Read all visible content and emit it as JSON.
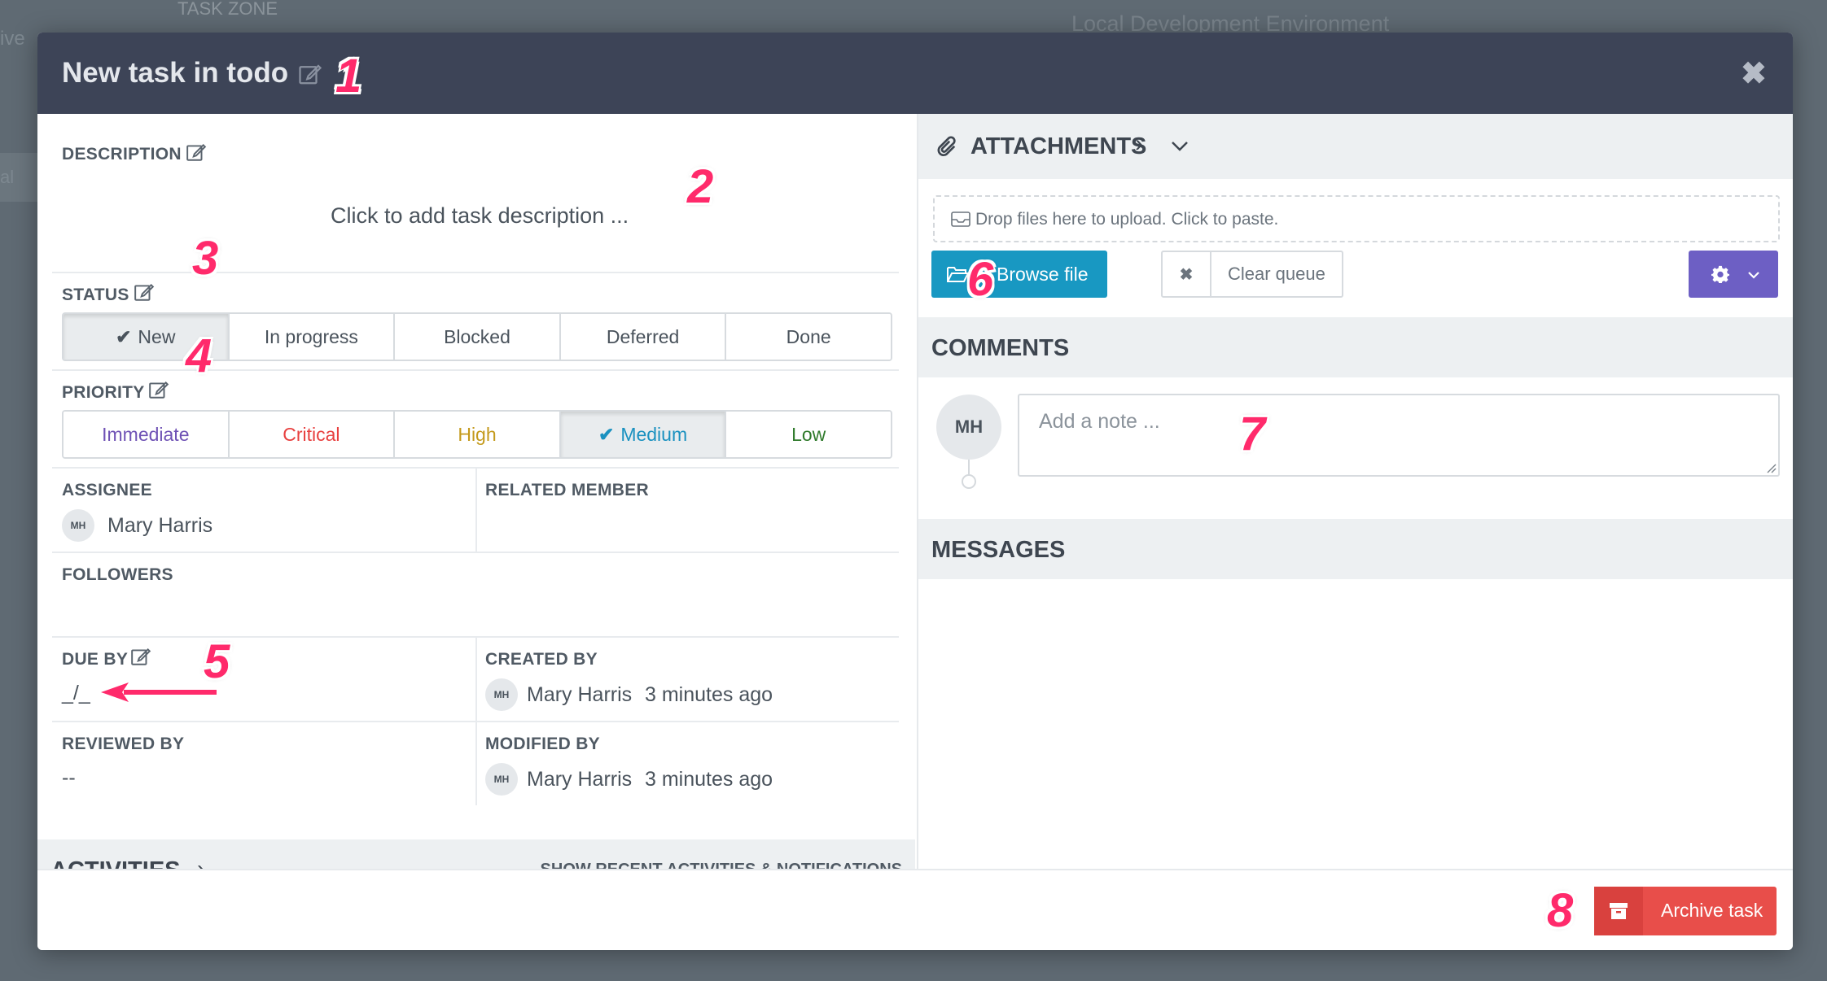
{
  "background": {
    "left_fragment": "ive",
    "top_fragment": "TASK ZONE",
    "right_title": "Local Development Environment",
    "side_fragment": "al"
  },
  "modal": {
    "title": "New task in todo"
  },
  "description": {
    "label": "DESCRIPTION",
    "placeholder": "Click to add task description ..."
  },
  "status": {
    "label": "STATUS",
    "options": [
      "New",
      "In progress",
      "Blocked",
      "Deferred",
      "Done"
    ],
    "selected": "New"
  },
  "priority": {
    "label": "PRIORITY",
    "options": [
      "Immediate",
      "Critical",
      "High",
      "Medium",
      "Low"
    ],
    "selected": "Medium",
    "colors": {
      "Immediate": "#6f52b5",
      "Critical": "#e8403f",
      "High": "#c49a1c",
      "Medium": "#1a91c0",
      "Low": "#2f7a2b"
    }
  },
  "assignee": {
    "label": "ASSIGNEE",
    "initials": "MH",
    "name": "Mary Harris"
  },
  "related_member": {
    "label": "RELATED MEMBER"
  },
  "followers": {
    "label": "FOLLOWERS"
  },
  "due_by": {
    "label": "DUE BY",
    "value": "_/_"
  },
  "created_by": {
    "label": "CREATED BY",
    "initials": "MH",
    "name": "Mary Harris",
    "time": "3 minutes ago"
  },
  "reviewed_by": {
    "label": "REVIEWED BY",
    "value": "--"
  },
  "modified_by": {
    "label": "MODIFIED BY",
    "initials": "MH",
    "name": "Mary Harris",
    "time": "3 minutes ago"
  },
  "activities": {
    "title": "ACTIVITIES",
    "link": "SHOW RECENT ACTIVITIES & NOTIFICATIONS"
  },
  "attachments": {
    "title": "ATTACHMENTS",
    "dropzone": "Drop files here to upload. Click to paste.",
    "browse_label": "Browse file",
    "clear_label": "Clear queue"
  },
  "comments": {
    "title": "COMMENTS",
    "avatar_initials": "MH",
    "note_placeholder": "Add a note ..."
  },
  "messages": {
    "title": "MESSAGES"
  },
  "footer": {
    "archive_label": "Archive task"
  },
  "callouts": [
    "1",
    "2",
    "3",
    "4",
    "5",
    "6",
    "7",
    "8"
  ],
  "colors": {
    "header_bg": "#3d4457",
    "browse_btn": "#1898c2",
    "gear_btn": "#6d5fc4",
    "archive_btn": "#e84e4a",
    "callout": "#ff2a6b"
  }
}
